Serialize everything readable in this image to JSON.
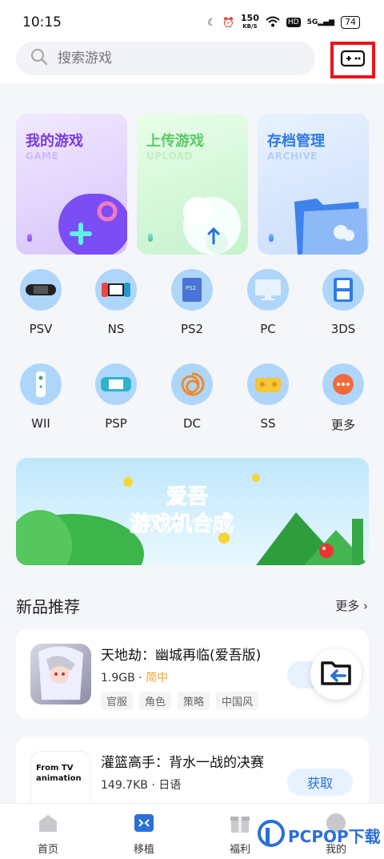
{
  "status": {
    "time": "10:15",
    "net_speed": "150",
    "net_unit": "KB/S",
    "hd": "HD",
    "signal": "5G",
    "battery": "74"
  },
  "search": {
    "placeholder": "搜索游戏"
  },
  "cards": [
    {
      "title": "我的游戏",
      "subtitle": "GAME"
    },
    {
      "title": "上传游戏",
      "subtitle": "UPLOAD"
    },
    {
      "title": "存档管理",
      "subtitle": "ARCHIVE"
    }
  ],
  "platforms": [
    {
      "label": "PSV",
      "icon": "psv-icon"
    },
    {
      "label": "NS",
      "icon": "ns-icon"
    },
    {
      "label": "PS2",
      "icon": "ps2-icon"
    },
    {
      "label": "PC",
      "icon": "pc-icon"
    },
    {
      "label": "3DS",
      "icon": "3ds-icon"
    },
    {
      "label": "WII",
      "icon": "wii-icon"
    },
    {
      "label": "PSP",
      "icon": "psp-icon"
    },
    {
      "label": "DC",
      "icon": "dc-icon"
    },
    {
      "label": "SS",
      "icon": "ss-icon"
    },
    {
      "label": "更多",
      "icon": "more-icon"
    }
  ],
  "banner": {
    "line1": "爱吾",
    "line2": "游戏机合成"
  },
  "section": {
    "title": "新品推荐",
    "more": "更多"
  },
  "games": [
    {
      "name": "天地劫：幽城再临(爱吾版)",
      "size": "1.9GB",
      "lang": "简中",
      "tags": [
        "官服",
        "角色",
        "策略",
        "中国风"
      ],
      "action": ""
    },
    {
      "name": "灌篮高手：背水一战的决赛",
      "size": "149.7KB",
      "lang": "日语",
      "tags": [
        "",
        "",
        "",
        ""
      ],
      "action": "获取",
      "thumb_text": "From TV animation"
    }
  ],
  "tabs": [
    {
      "label": "首页"
    },
    {
      "label": "移植"
    },
    {
      "label": "福利"
    },
    {
      "label": "我的"
    }
  ],
  "watermark": {
    "text": "PCPOP下载"
  },
  "colors": {
    "highlight": "#e8141b",
    "accent": "#2a6fd9"
  }
}
